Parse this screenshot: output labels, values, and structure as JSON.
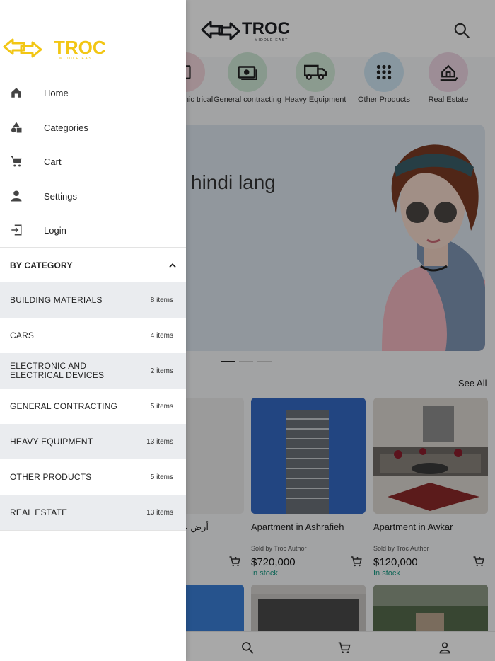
{
  "brand": {
    "name": "TROC",
    "tagline": "MIDDLE EAST",
    "accent": "#f2c614",
    "dark": "#1d1f24"
  },
  "top_categories": [
    {
      "label": "Electronic and Electrical",
      "partial_label": "nic trical",
      "icon": "plug-icon",
      "bg": "#f3d6dc"
    },
    {
      "label": "General contracting",
      "icon": "cash-icon",
      "bg": "#cfe9d6"
    },
    {
      "label": "Heavy Equipment",
      "icon": "truck-icon",
      "bg": "#d4ecd9"
    },
    {
      "label": "Other Products",
      "icon": "grid-icon",
      "bg": "#cfe6f3"
    },
    {
      "label": "Real Estate",
      "icon": "house-hand-icon",
      "bg": "#eed6e4"
    }
  ],
  "banner": {
    "text": "hindi lang"
  },
  "section": {
    "see_all": "See All"
  },
  "products": [
    {
      "title": "أرض عا",
      "seller": "",
      "price": "",
      "stock": ""
    },
    {
      "title": "Apartment in Ashrafieh",
      "seller": "Sold by Troc Author",
      "price": "$720,000",
      "stock": "In stock"
    },
    {
      "title": "Apartment in Awkar",
      "seller": "Sold by Troc Author",
      "price": "$120,000",
      "stock": "In stock"
    }
  ],
  "drawer": {
    "nav": [
      {
        "label": "Home",
        "icon": "home-icon"
      },
      {
        "label": "Categories",
        "icon": "shapes-icon"
      },
      {
        "label": "Cart",
        "icon": "cart-icon"
      },
      {
        "label": "Settings",
        "icon": "person-icon"
      },
      {
        "label": "Login",
        "icon": "login-icon"
      }
    ],
    "by_category_label": "BY CATEGORY",
    "categories": [
      {
        "name": "BUILDING MATERIALS",
        "count": "8 items"
      },
      {
        "name": "CARS",
        "count": "4 items"
      },
      {
        "name": "ELECTRONIC AND ELECTRICAL DEVICES",
        "count": "2 items"
      },
      {
        "name": "GENERAL CONTRACTING",
        "count": "5 items"
      },
      {
        "name": "HEAVY EQUIPMENT",
        "count": "13 items"
      },
      {
        "name": "OTHER PRODUCTS",
        "count": "5 items"
      },
      {
        "name": "REAL ESTATE",
        "count": "13 items"
      }
    ]
  },
  "bottom_nav": [
    {
      "icon": "search-icon"
    },
    {
      "icon": "cart-icon"
    },
    {
      "icon": "account-icon"
    }
  ]
}
